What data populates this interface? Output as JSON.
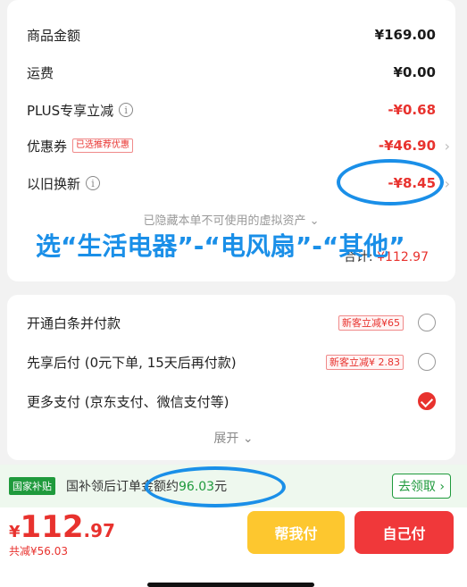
{
  "summary": {
    "goods_amount_label": "商品金额",
    "goods_amount_value": "¥169.00",
    "shipping_label": "运费",
    "shipping_value": "¥0.00",
    "plus_label": "PLUS专享立减",
    "plus_value": "-¥0.68",
    "coupon_label": "优惠券",
    "coupon_tag": "已选推荐优惠",
    "coupon_value": "-¥46.90",
    "tradein_label": "以旧换新",
    "tradein_value": "-¥8.45",
    "hidden_note": "已隐藏本单不可使用的虚拟资产",
    "total_label": "合计: ",
    "total_value": "¥112.97"
  },
  "overlay_annotation": "选“生活电器”-“电风扇”-“其他”",
  "payment": {
    "options": [
      {
        "label": "开通白条并付款",
        "promo": "新客立减¥65",
        "selected": false
      },
      {
        "label": "先享后付 (0元下单, 15天后再付款)",
        "promo": "新客立减¥ 2.83",
        "selected": false
      },
      {
        "label": "更多支付 (京东支付、微信支付等)",
        "promo": "",
        "selected": true
      }
    ],
    "expand_label": "展开"
  },
  "subsidy": {
    "badge": "国家补贴",
    "text_prefix": "国补领后订单金额约",
    "amount": "96.03",
    "text_suffix": "元",
    "button": "去领取"
  },
  "footer": {
    "currency": "¥",
    "price_int": "112",
    "price_dec": ".97",
    "saved": "共减¥56.03",
    "help_pay": "帮我付",
    "self_pay": "自己付"
  },
  "colors": {
    "accent_red": "#e8322e",
    "annotation_blue": "#1a8fe8",
    "subsidy_green": "#1f9a3c"
  }
}
